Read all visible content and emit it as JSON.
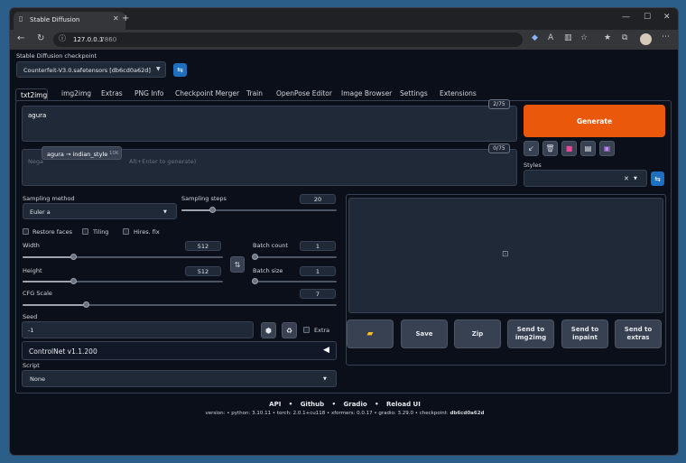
{
  "browser": {
    "tab_title": "Stable Diffusion",
    "url_host": "127.0.0.1",
    "url_port": ":7860"
  },
  "checkpoint": {
    "label": "Stable Diffusion checkpoint",
    "value": "Counterfeit-V3.0.safetensors [db6cd0a62d]"
  },
  "tabs": [
    "txt2img",
    "img2img",
    "Extras",
    "PNG Info",
    "Checkpoint Merger",
    "Train",
    "OpenPose Editor",
    "Image Browser",
    "Settings",
    "Extensions"
  ],
  "prompt": {
    "value": "agura",
    "token_count": "2/75",
    "autocomplete": "agura → indian_style",
    "autocomplete_count": "10K"
  },
  "negative_prompt": {
    "placeholder_start": "Nega",
    "placeholder_end": "Alt+Enter to generate)",
    "token_count": "0/75"
  },
  "generate_label": "Generate",
  "styles_label": "Styles",
  "sampling": {
    "method_label": "Sampling method",
    "method_value": "Euler a",
    "steps_label": "Sampling steps",
    "steps_value": "20",
    "steps_fraction": 0.2
  },
  "options": {
    "restore_faces": "Restore faces",
    "tiling": "Tiling",
    "hires_fix": "Hires. fix"
  },
  "width": {
    "label": "Width",
    "value": "512",
    "fraction": 0.25
  },
  "height": {
    "label": "Height",
    "value": "512",
    "fraction": 0.25
  },
  "batch_count": {
    "label": "Batch count",
    "value": "1",
    "fraction": 0.0
  },
  "batch_size": {
    "label": "Batch size",
    "value": "1",
    "fraction": 0.0
  },
  "cfg": {
    "label": "CFG Scale",
    "value": "7",
    "fraction": 0.2
  },
  "seed": {
    "label": "Seed",
    "value": "-1",
    "extra_label": "Extra"
  },
  "controlnet_label": "ControlNet v1.1.200",
  "script": {
    "label": "Script",
    "value": "None"
  },
  "output_buttons": [
    "Save",
    "Zip",
    "Send to img2img",
    "Send to inpaint",
    "Send to extras"
  ],
  "footer": {
    "links": [
      "API",
      "Github",
      "Gradio",
      "Reload UI"
    ],
    "version_line": "version: • python: 3.10.11 • torch: 2.0.1+cu118 • xformers: 0.0.17 • gradio: 3.29.0 • checkpoint:",
    "checkpoint_hash": "db6cd0a62d"
  },
  "colors": {
    "generate": "#ea580c",
    "background": "#0b0f19",
    "panel": "#1f2937"
  }
}
